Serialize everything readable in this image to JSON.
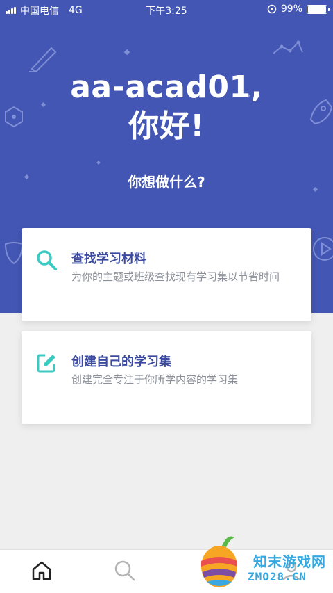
{
  "status_bar": {
    "carrier": "中国电信",
    "network": "4G",
    "time": "下午3:25",
    "battery_percent": "99%",
    "battery_level": 0.99
  },
  "hero": {
    "greeting_name": "aa-acad01,",
    "greeting_hello": "你好!",
    "question": "你想做什么?"
  },
  "cards": [
    {
      "icon": "search-icon",
      "title": "查找学习材料",
      "description": "为你的主题或班级查找现有学习集以节省时间"
    },
    {
      "icon": "edit-icon",
      "title": "创建自己的学习集",
      "description": "创建完全专注于你所学内容的学习集"
    }
  ],
  "bottom_nav": {
    "items": [
      "home-icon",
      "search-icon",
      "profile-icon"
    ]
  },
  "watermark": {
    "text_cn": "知末游戏网",
    "text_en": "ZMO28.CN"
  },
  "colors": {
    "hero_bg": "#4356b4",
    "title": "#3b4a9e",
    "accent_teal": "#3ccbc3",
    "muted": "#8a8f99"
  }
}
